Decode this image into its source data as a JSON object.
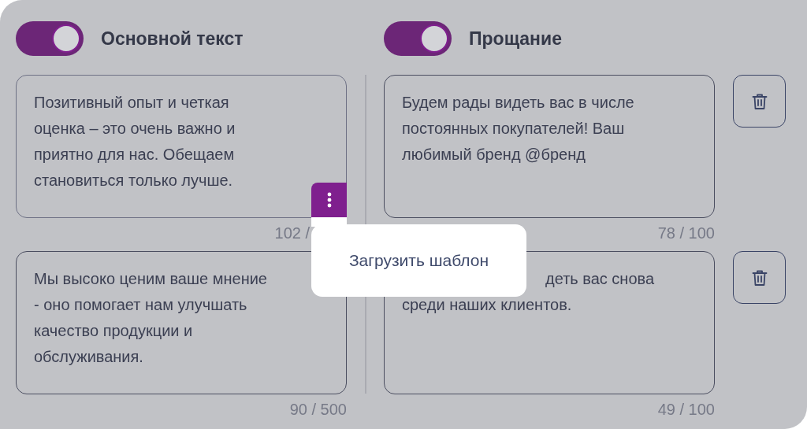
{
  "columns": [
    {
      "toggle": {
        "on": true
      },
      "title": "Основной текст",
      "cards": [
        {
          "lines": [
            "Позитивный опыт и четкая",
            "оценка – это очень важно и",
            "приятно для нас. Обещаем",
            "становиться только лучше."
          ],
          "counter": "102 /",
          "menu": {
            "open": true,
            "items": [
              "Загрузить шаблон"
            ]
          }
        },
        {
          "lines": [
            "Мы высоко ценим ваше мнение",
            "- оно помогает нам улучшать",
            "качество продукции и",
            "обслуживания."
          ],
          "counter": "90 / 500"
        }
      ]
    },
    {
      "toggle": {
        "on": true
      },
      "title": "Прощание",
      "cards": [
        {
          "lines": [
            "Будем рады видеть вас в числе",
            "постоянных покупателей! Ваш",
            "любимый бренд @бренд"
          ],
          "counter": "78 / 100",
          "deletable": true
        },
        {
          "lines": [
            "деть вас снова",
            "среди наших клиентов."
          ],
          "counter": "49 / 100",
          "deletable": true
        }
      ]
    }
  ]
}
